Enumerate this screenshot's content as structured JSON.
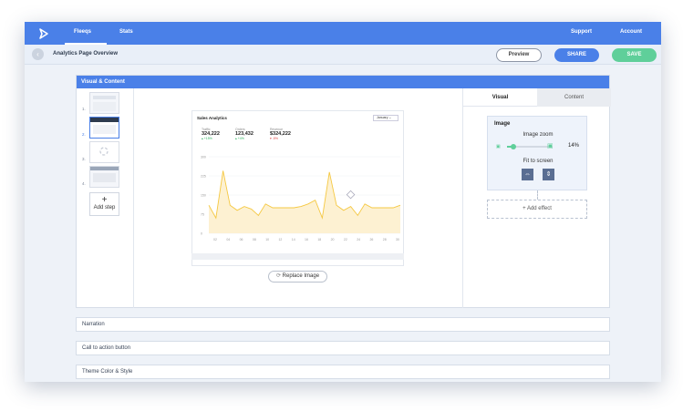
{
  "nav": {
    "items": [
      "Fleeqs",
      "Stats"
    ],
    "support": "Support",
    "account": "Account"
  },
  "subbar": {
    "title": "Analytics Page Overview",
    "preview": "Preview",
    "share": "SHARE",
    "save": "SAVE"
  },
  "panel": {
    "title": "Visual & Content",
    "steps": [
      "1.",
      "2.",
      "3.",
      "4."
    ],
    "add_step": "Add step",
    "replace_image": "Replace Image"
  },
  "analytics": {
    "title": "Sales Analytics",
    "period": "January",
    "metrics": [
      {
        "label": "Traffic",
        "value": "324,222",
        "change": "+15%",
        "trend": "up"
      },
      {
        "label": "Orders",
        "value": "123,432",
        "change": "+4%",
        "trend": "up"
      },
      {
        "label": "Revenue",
        "value": "$324,222",
        "change": "-5%",
        "trend": "down"
      }
    ]
  },
  "chart_data": {
    "type": "area",
    "x": [
      "02",
      "04",
      "06",
      "08",
      "10",
      "12",
      "14",
      "16",
      "18",
      "20",
      "22",
      "24",
      "26",
      "28",
      "30"
    ],
    "y_ticks": [
      "300",
      "225",
      "150",
      "75",
      "0"
    ],
    "ylim": [
      0,
      300
    ],
    "values": [
      110,
      60,
      245,
      110,
      90,
      105,
      95,
      70,
      115,
      100,
      100,
      100,
      100,
      105,
      115,
      130,
      60,
      240,
      110,
      90,
      105,
      70,
      115,
      100,
      100,
      100,
      100,
      110
    ],
    "color": "#f5c842"
  },
  "right": {
    "tabs": [
      "Visual",
      "Content"
    ],
    "image_heading": "Image",
    "zoom_label": "Image zoom",
    "zoom_value": "14%",
    "zoom_fraction": 0.14,
    "fit_label": "Fit to screen",
    "add_effect": "+ Add effect"
  },
  "fields": [
    "Narration",
    "Call to action button",
    "Theme Color & Style"
  ],
  "colors": {
    "primary": "#4a80e8",
    "save": "#5fcf9a",
    "chart": "#f5c842",
    "up": "#2fb360",
    "down": "#e04646"
  }
}
